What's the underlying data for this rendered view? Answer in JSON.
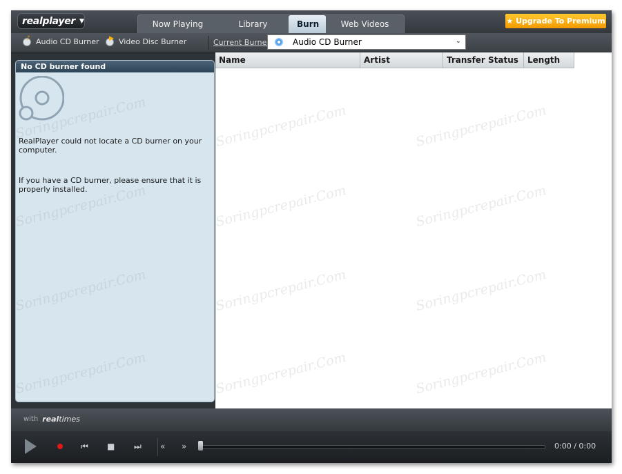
{
  "app": {
    "logo_text": "realplayer"
  },
  "tabs": [
    {
      "label": "Now Playing",
      "active": false
    },
    {
      "label": "Library",
      "active": false
    },
    {
      "label": "Burn",
      "active": true
    },
    {
      "label": "Web Videos",
      "active": false
    }
  ],
  "upgrade_button": {
    "label": "Upgrade To Premium",
    "icon": "star-icon"
  },
  "toolbar": {
    "audio_cd_label": "Audio CD Burner",
    "video_disc_label": "Video Disc Burner",
    "current_burner_label": "Current Burner",
    "selected_burner": "Audio CD Burner"
  },
  "left_panel": {
    "header": "No CD burner found",
    "message1": "RealPlayer could not locate a CD burner on your computer.",
    "message2": "If you have a CD burner, please ensure that it is properly installed."
  },
  "table": {
    "columns": [
      "Name",
      "Artist",
      "Transfer Status",
      "Length"
    ]
  },
  "footer": {
    "with_label": "with",
    "realtimes_bold": "real",
    "realtimes_rest": "times"
  },
  "player": {
    "time": "0:00 / 0:00",
    "progress": 0
  },
  "watermark": "Soringpcrepair.Com",
  "colors": {
    "accent": "#f6a800",
    "active_tab": "#cfdde8",
    "panel_bg": "#d6e5ee",
    "record": "#e01818"
  }
}
